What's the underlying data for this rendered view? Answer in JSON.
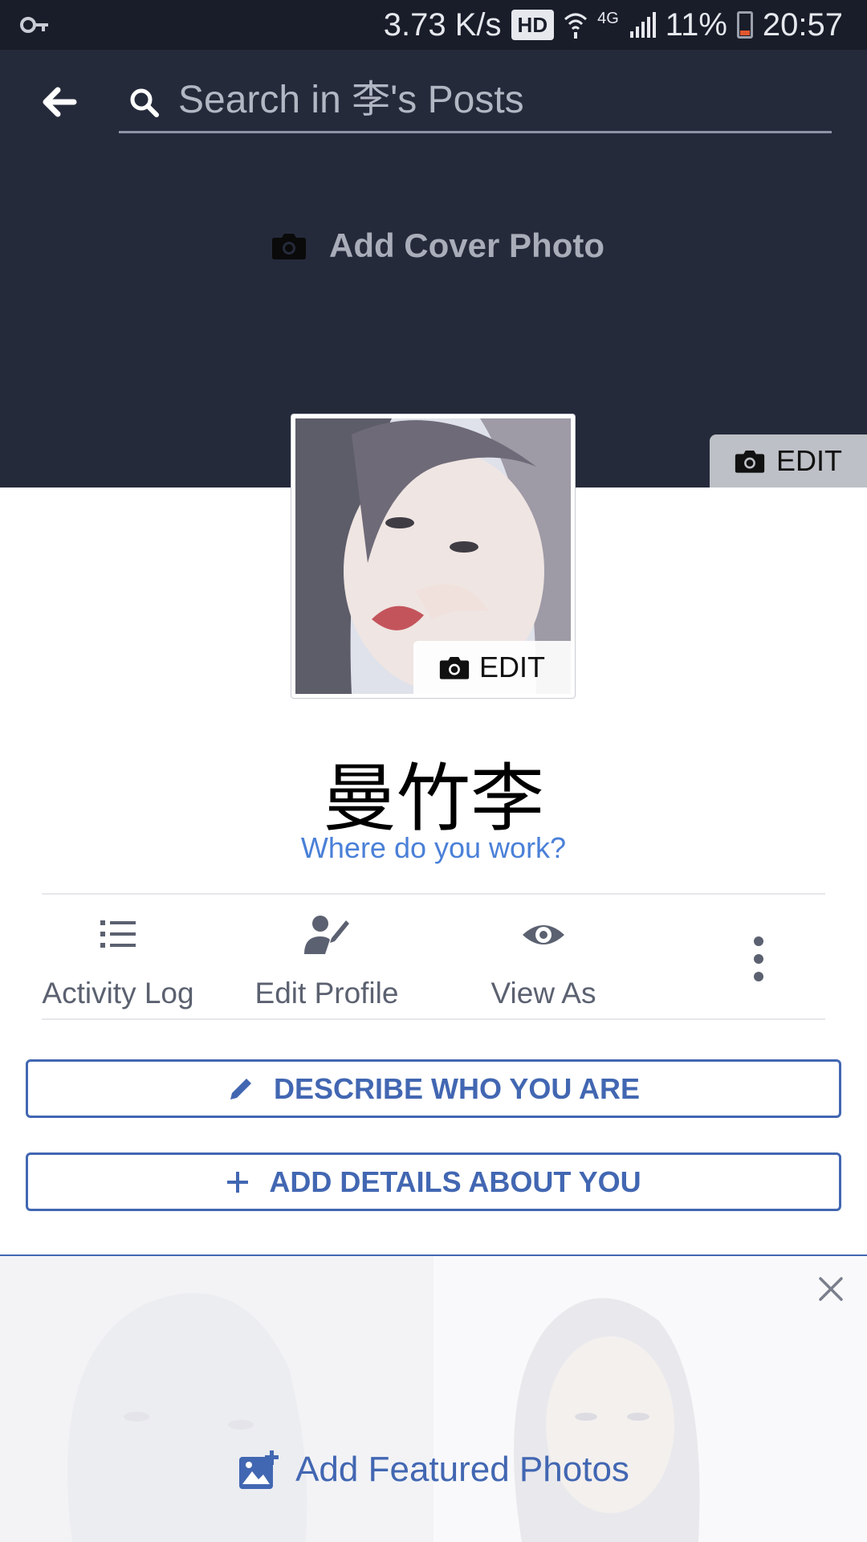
{
  "status_bar": {
    "net_speed": "3.73 K/s",
    "hd": "HD",
    "network": "4G",
    "battery": "11%",
    "time": "20:57"
  },
  "search": {
    "placeholder": "Search in 李's Posts"
  },
  "cover": {
    "add_cover_label": "Add Cover Photo",
    "edit_label": "EDIT"
  },
  "profile_picture": {
    "edit_label": "EDIT"
  },
  "profile": {
    "name": "曼竹李",
    "work_prompt": "Where do you work?"
  },
  "actions": {
    "activity_log": "Activity Log",
    "edit_profile": "Edit Profile",
    "view_as": "View As"
  },
  "buttons": {
    "describe": "DESCRIBE WHO YOU ARE",
    "add_details": "ADD DETAILS ABOUT YOU"
  },
  "featured": {
    "add_label": "Add Featured Photos"
  },
  "colors": {
    "header_bg": "#252a3b",
    "brand_blue": "#4267b2",
    "link_blue": "#4a80d8"
  }
}
